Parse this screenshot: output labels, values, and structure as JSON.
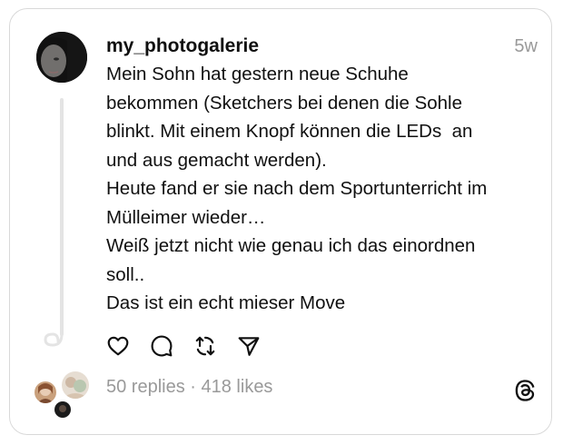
{
  "post": {
    "username": "my_photogalerie",
    "time": "5w",
    "text_lines": [
      "Mein Sohn hat gestern neue Schuhe",
      "bekommen (Sketchers bei denen die Sohle",
      "blinkt. Mit einem Knopf können die LEDs  an",
      "und aus gemacht werden).",
      "Heute fand er sie nach dem Sportunterricht im",
      "Mülleimer wieder…",
      "Weiß jetzt nicht wie genau ich das einordnen",
      "soll..",
      "Das ist ein echt mieser Move"
    ]
  },
  "actions": {
    "like_icon": "heart-icon",
    "reply_icon": "comment-icon",
    "repost_icon": "repost-icon",
    "share_icon": "send-icon"
  },
  "stats": {
    "replies": "50 replies",
    "separator": " · ",
    "likes": "418 likes"
  },
  "colors": {
    "text": "#101010",
    "muted": "#999999",
    "border": "#d9d9d9",
    "thread_line": "#e4e4e4"
  }
}
